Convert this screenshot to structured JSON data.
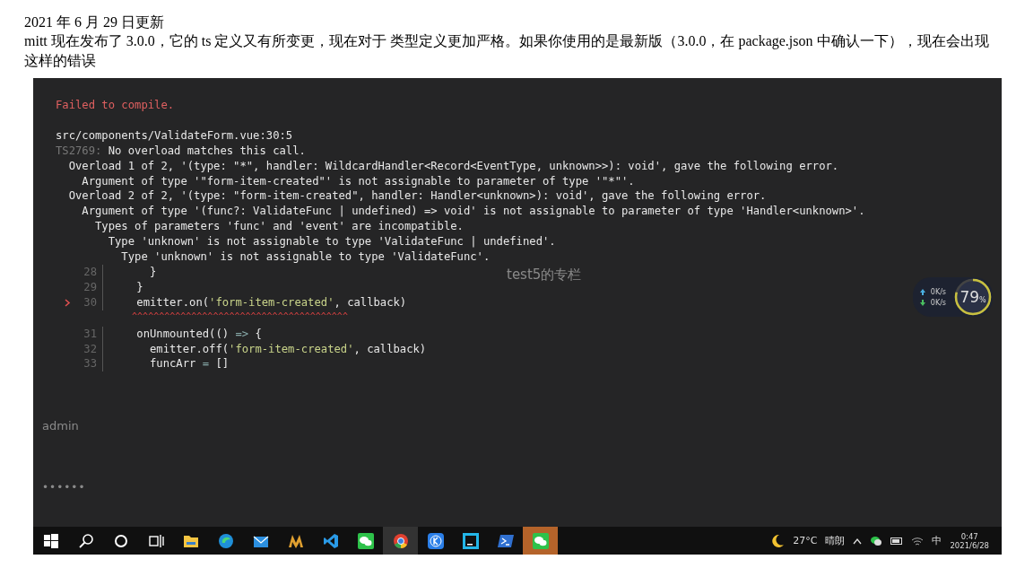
{
  "heading": "2021 年 6 月 29 日更新",
  "paragraph": "mitt 现在发布了 3.0.0，它的 ts 定义又有所变更，现在对于 类型定义更加严格。如果你使用的是最新版（3.0.0，在 package.json 中确认一下），现在会出现这样的错误",
  "screenshot": {
    "background_texts": [
      {
        "kind": "title",
        "text": "test5的专栏"
      },
      {
        "kind": "input",
        "text": "admin"
      },
      {
        "kind": "password",
        "text": "••••••"
      }
    ],
    "error": {
      "title": "Failed to compile.",
      "file": "src/components/ValidateForm.vue:30:5",
      "code": "TS2769:",
      "summary": " No overload matches this call.",
      "details": [
        "  Overload 1 of 2, '(type: \"*\", handler: WildcardHandler<Record<EventType, unknown>>): void', gave the following error.",
        "    Argument of type '\"form-item-created\"' is not assignable to parameter of type '\"*\"'.",
        "  Overload 2 of 2, '(type: \"form-item-created\", handler: Handler<unknown>): void', gave the following error.",
        "    Argument of type '(func?: ValidateFunc | undefined) => void' is not assignable to parameter of type 'Handler<unknown>'.",
        "      Types of parameters 'func' and 'event' are incompatible.",
        "        Type 'unknown' is not assignable to type 'ValidateFunc | undefined'.",
        "          Type 'unknown' is not assignable to type 'ValidateFunc'."
      ],
      "frame": [
        {
          "kind": "code",
          "number": "28",
          "marker": false,
          "segments": [
            {
              "kind": "plain",
              "text": "      }"
            }
          ]
        },
        {
          "kind": "code",
          "number": "29",
          "marker": false,
          "segments": [
            {
              "kind": "plain",
              "text": "    }"
            }
          ]
        },
        {
          "kind": "code",
          "number": "30",
          "marker": true,
          "segments": [
            {
              "kind": "plain",
              "text": "    emitter.on("
            },
            {
              "kind": "string",
              "text": "'form-item-created'"
            },
            {
              "kind": "plain",
              "text": ", callback)"
            }
          ]
        },
        {
          "kind": "underline",
          "text": "    ^^^^^^^^^^^^^^^^^^^^^^^^^^^^^^^^^^^^^^^^"
        },
        {
          "kind": "code",
          "number": "31",
          "marker": false,
          "segments": [
            {
              "kind": "plain",
              "text": "    onUnmounted(() "
            },
            {
              "kind": "operator",
              "text": "=>"
            },
            {
              "kind": "plain",
              "text": " {"
            }
          ]
        },
        {
          "kind": "code",
          "number": "32",
          "marker": false,
          "segments": [
            {
              "kind": "plain",
              "text": "      emitter.off("
            },
            {
              "kind": "string",
              "text": "'form-item-created'"
            },
            {
              "kind": "plain",
              "text": ", callback)"
            }
          ]
        },
        {
          "kind": "code",
          "number": "33",
          "marker": false,
          "segments": [
            {
              "kind": "plain",
              "text": "      funcArr "
            },
            {
              "kind": "operator",
              "text": "="
            },
            {
              "kind": "plain",
              "text": " []"
            }
          ]
        }
      ]
    },
    "net_widget": {
      "upload": "0K/s",
      "download": "0K/s",
      "percent": "79",
      "unit": "%",
      "level": 0.79
    },
    "taskbar": {
      "apps": [
        {
          "kind": "start",
          "selected": false,
          "flashing": false
        },
        {
          "kind": "search",
          "selected": false,
          "flashing": false
        },
        {
          "kind": "cortana",
          "selected": false,
          "flashing": false
        },
        {
          "kind": "taskview",
          "selected": false,
          "flashing": false
        },
        {
          "kind": "folder",
          "selected": false,
          "flashing": false
        },
        {
          "kind": "edge",
          "selected": false,
          "flashing": false
        },
        {
          "kind": "mail",
          "selected": false,
          "flashing": false
        },
        {
          "kind": "mlogo",
          "selected": false,
          "flashing": false
        },
        {
          "kind": "vscode",
          "selected": false,
          "flashing": false
        },
        {
          "kind": "wechat",
          "selected": false,
          "flashing": false
        },
        {
          "kind": "chrome",
          "selected": true,
          "flashing": false
        },
        {
          "kind": "kapp",
          "selected": false,
          "flashing": false
        },
        {
          "kind": "ide",
          "selected": false,
          "flashing": false
        },
        {
          "kind": "terminal",
          "selected": false,
          "flashing": false
        },
        {
          "kind": "wechat",
          "selected": false,
          "flashing": true
        }
      ],
      "weather": {
        "temp": "27°C",
        "condition": "晴朗"
      },
      "ime": "中",
      "time": "0:47",
      "date": "2021/6/28"
    }
  }
}
